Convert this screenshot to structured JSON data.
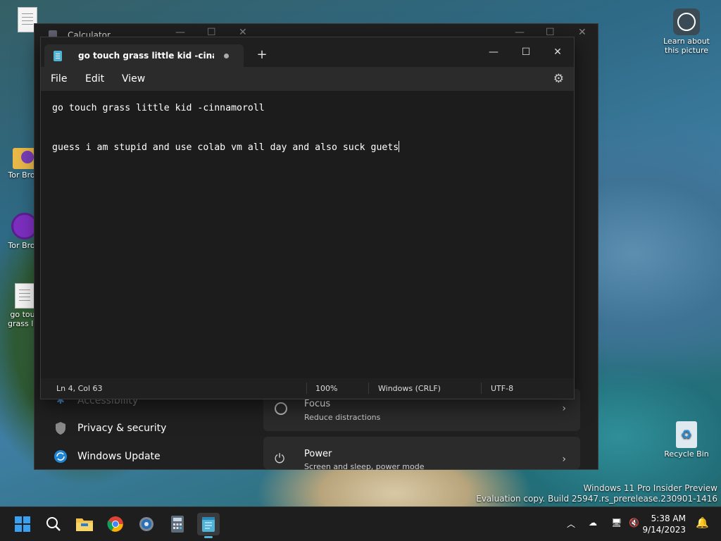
{
  "desktop": {
    "icons": [
      {
        "label": "Tor Brow"
      },
      {
        "label": "Tor Brow"
      },
      {
        "label": "go touc grass litt"
      },
      {
        "label": "Learn about this picture"
      },
      {
        "label": "Recycle Bin"
      }
    ],
    "watermark": {
      "line1": "Windows 11 Pro Insider Preview",
      "line2": "Evaluation copy. Build 25947.rs_prerelease.230901-1416"
    }
  },
  "background_window": {
    "title": "Calculator",
    "settings_items": [
      {
        "label": "Accessibility"
      },
      {
        "label": "Privacy & security"
      },
      {
        "label": "Windows Update"
      }
    ],
    "cards": [
      {
        "title": "Focus",
        "subtitle": "Reduce distractions"
      },
      {
        "title": "Power",
        "subtitle": "Screen and sleep, power mode"
      }
    ]
  },
  "notepad": {
    "tab_title": "go touch grass little kid -cinamonr",
    "menu": [
      "File",
      "Edit",
      "View"
    ],
    "lines": [
      "go touch grass little kid -cinnamoroll",
      "guess i am stupid and use colab vm all day and also suck guets"
    ],
    "status": {
      "position": "Ln 4, Col 63",
      "zoom": "100%",
      "line_ending": "Windows (CRLF)",
      "encoding": "UTF-8"
    }
  },
  "taskbar": {
    "apps": [
      "start-icon",
      "search-icon",
      "file-explorer-icon",
      "chrome-icon",
      "settings-icon",
      "calculator-icon",
      "notepad-icon"
    ],
    "clock": {
      "time": "5:38 AM",
      "date": "9/14/2023"
    }
  }
}
